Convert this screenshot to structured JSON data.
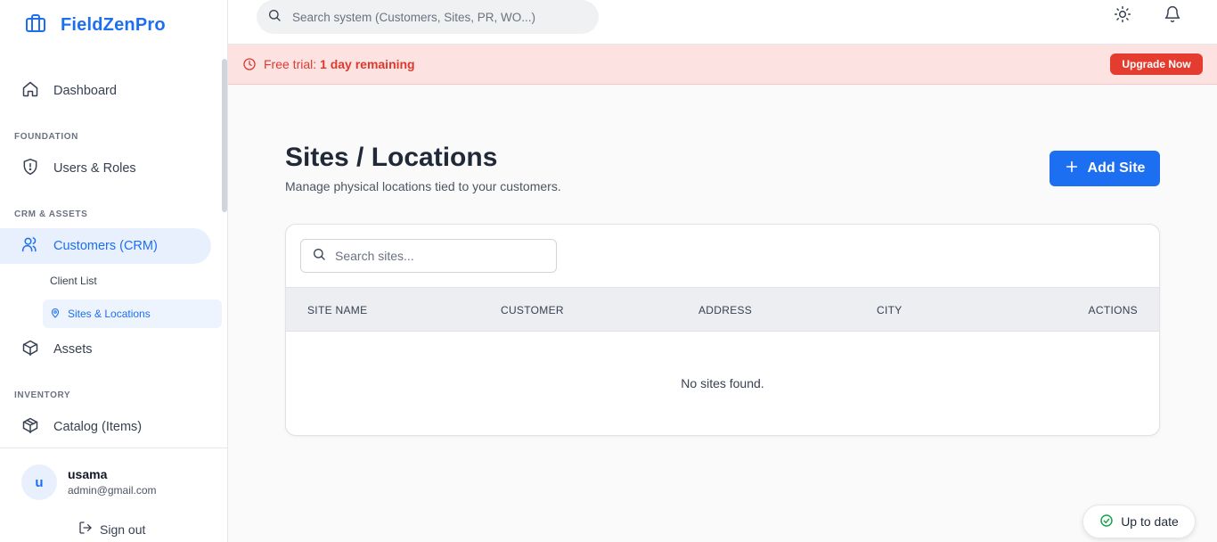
{
  "brand": {
    "name": "FieldZenPro"
  },
  "sidebar": {
    "dashboard": "Dashboard",
    "sections": {
      "foundation": "FOUNDATION",
      "crm": "CRM & ASSETS",
      "inventory": "INVENTORY"
    },
    "users_roles": "Users & Roles",
    "customers": "Customers (CRM)",
    "client_list": "Client List",
    "sites_locations": "Sites & Locations",
    "assets": "Assets",
    "catalog": "Catalog (Items)"
  },
  "user": {
    "initial": "u",
    "name": "usama",
    "email": "admin@gmail.com",
    "sign_out": "Sign out"
  },
  "topbar": {
    "search_placeholder": "Search system (Customers, Sites, PR, WO...)"
  },
  "trial": {
    "prefix": "Free trial: ",
    "remaining": "1 day remaining",
    "upgrade_label": "Upgrade Now"
  },
  "page": {
    "title": "Sites / Locations",
    "subtitle": "Manage physical locations tied to your customers.",
    "add_label": "Add Site"
  },
  "table": {
    "search_placeholder": "Search sites...",
    "columns": [
      "SITE NAME",
      "CUSTOMER",
      "ADDRESS",
      "CITY",
      "ACTIONS"
    ],
    "empty": "No sites found."
  },
  "status": {
    "label": "Up to date"
  },
  "colors": {
    "accent": "#1d6ff2",
    "danger": "#e43d2f",
    "success": "#16a34a"
  }
}
